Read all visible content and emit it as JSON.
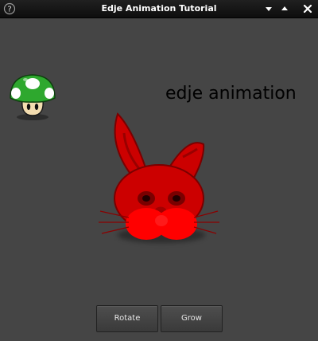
{
  "window": {
    "title": "Edje Animation Tutorial"
  },
  "content": {
    "heading": "edje animation"
  },
  "buttons": {
    "rotate": "Rotate",
    "grow": "Grow"
  },
  "icons": {
    "help": "help-icon",
    "minimize": "minimize-icon",
    "maximize": "maximize-icon",
    "close": "close-icon",
    "mushroom": "mushroom-icon",
    "rabbit": "rabbit-image"
  },
  "colors": {
    "background": "#454545",
    "titlebar": "#111111",
    "rabbit": "#ff0000",
    "mushroom_cap": "#2fa82f"
  }
}
